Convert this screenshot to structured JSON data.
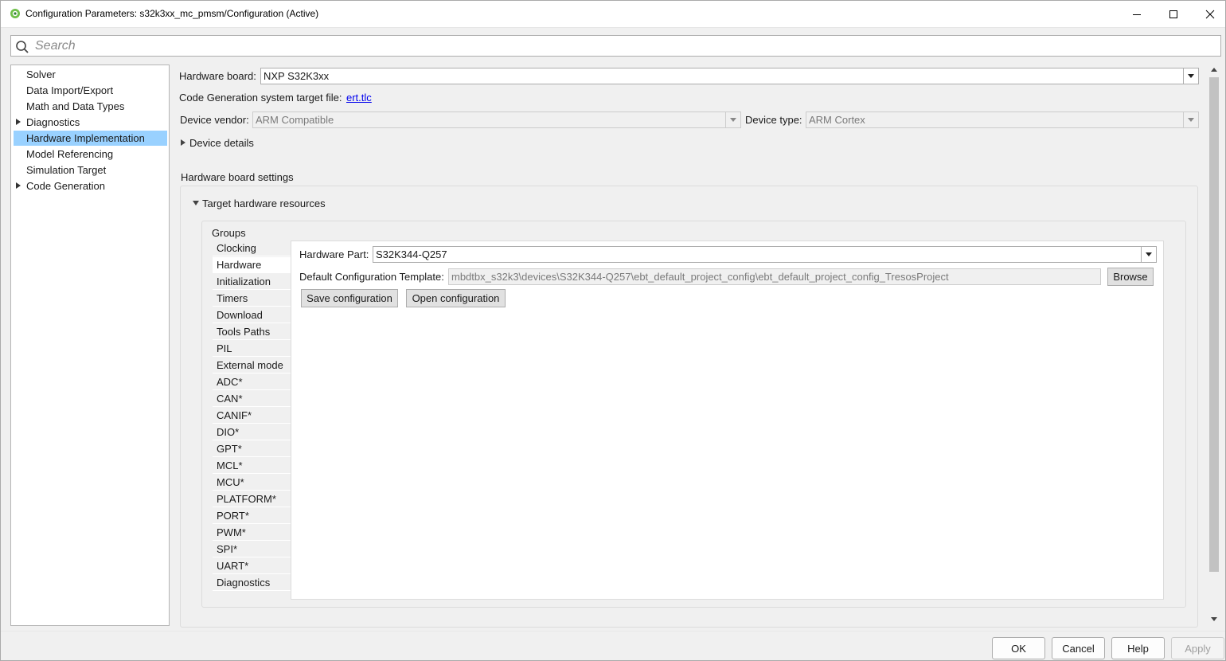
{
  "window": {
    "title": "Configuration Parameters: s32k3xx_mc_pmsm/Configuration (Active)"
  },
  "search": {
    "placeholder": "Search"
  },
  "sidebar": {
    "items": [
      {
        "label": "Solver",
        "expandable": false,
        "selected": false
      },
      {
        "label": "Data Import/Export",
        "expandable": false,
        "selected": false
      },
      {
        "label": "Math and Data Types",
        "expandable": false,
        "selected": false
      },
      {
        "label": "Diagnostics",
        "expandable": true,
        "selected": false
      },
      {
        "label": "Hardware Implementation",
        "expandable": false,
        "selected": true
      },
      {
        "label": "Model Referencing",
        "expandable": false,
        "selected": false
      },
      {
        "label": "Simulation Target",
        "expandable": false,
        "selected": false
      },
      {
        "label": "Code Generation",
        "expandable": true,
        "selected": false
      }
    ]
  },
  "main": {
    "hardware_board_label": "Hardware board:",
    "hardware_board_value": "NXP S32K3xx",
    "codegen_target_label": "Code Generation system target file:",
    "codegen_target_link": "ert.tlc",
    "device_vendor_label": "Device vendor:",
    "device_vendor_value": "ARM Compatible",
    "device_type_label": "Device type:",
    "device_type_value": "ARM Cortex",
    "device_details_label": "Device details",
    "board_settings_label": "Hardware board settings",
    "target_resources_label": "Target hardware resources",
    "groups_label": "Groups",
    "groups": [
      "Clocking",
      "Hardware",
      "Initialization",
      "Timers",
      "Download",
      "Tools Paths",
      "PIL",
      "External mode",
      "ADC*",
      "CAN*",
      "CANIF*",
      "DIO*",
      "GPT*",
      "MCL*",
      "MCU*",
      "PLATFORM*",
      "PORT*",
      "PWM*",
      "SPI*",
      "UART*",
      "Diagnostics"
    ],
    "selected_group": "Hardware",
    "hardware_part_label": "Hardware Part:",
    "hardware_part_value": "S32K344-Q257",
    "default_template_label": "Default Configuration Template:",
    "default_template_value": "mbdtbx_s32k3\\devices\\S32K344-Q257\\ebt_default_project_config\\ebt_default_project_config_TresosProject",
    "browse_label": "Browse",
    "save_config_label": "Save configuration",
    "open_config_label": "Open configuration"
  },
  "footer": {
    "ok_label": "OK",
    "cancel_label": "Cancel",
    "help_label": "Help",
    "apply_label": "Apply"
  },
  "colors": {
    "selection": "#99d1ff",
    "link": "#0000ee",
    "background": "#f0f0f0"
  }
}
